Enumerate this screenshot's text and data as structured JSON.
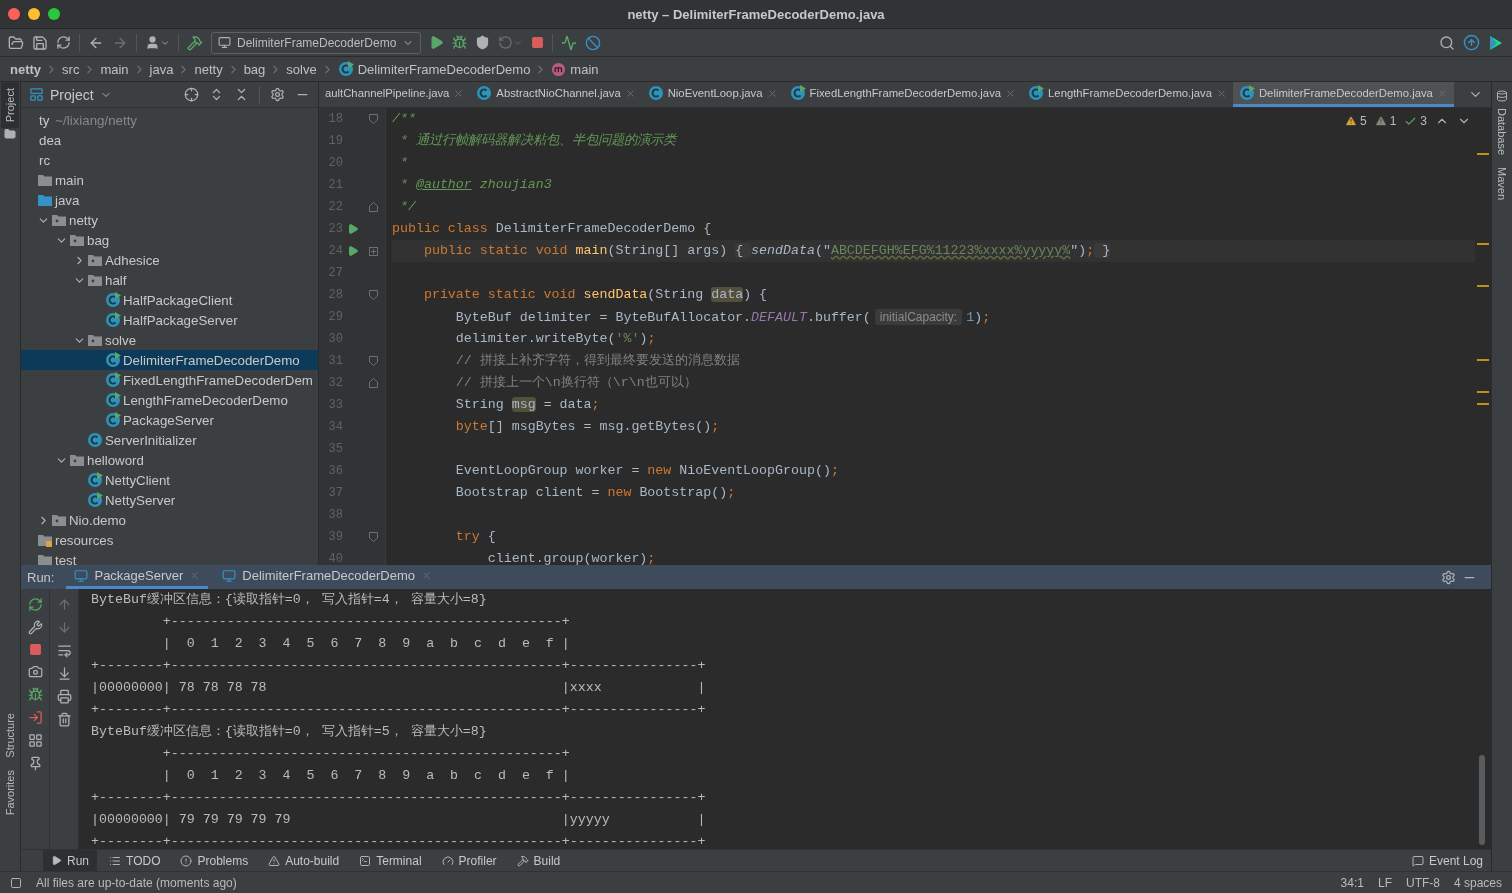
{
  "window": {
    "title": "netty – DelimiterFrameDecoderDemo.java"
  },
  "toolbar": {
    "run_config": "DelimiterFrameDecoderDemo"
  },
  "breadcrumb": [
    {
      "label": "netty",
      "kind": "root"
    },
    {
      "label": "src",
      "kind": "dir"
    },
    {
      "label": "main",
      "kind": "dir"
    },
    {
      "label": "java",
      "kind": "dir"
    },
    {
      "label": "netty",
      "kind": "dir"
    },
    {
      "label": "bag",
      "kind": "dir"
    },
    {
      "label": "solve",
      "kind": "dir"
    },
    {
      "label": "DelimiterFrameDecoderDemo",
      "kind": "class"
    },
    {
      "label": "main",
      "kind": "method"
    }
  ],
  "left_strip": [
    {
      "label": "Project",
      "selected": true
    },
    {
      "label": "Structure",
      "selected": false
    },
    {
      "label": "Favorites",
      "selected": false
    }
  ],
  "right_strip": [
    {
      "label": "Database"
    },
    {
      "label": "Maven"
    }
  ],
  "project_panel": {
    "title": "Project",
    "tree": [
      {
        "label": "ty",
        "path": "~/lixiang/netty",
        "selected": false,
        "children": [
          {
            "label": "dea",
            "selected": false
          },
          {
            "label": "rc",
            "selected": false,
            "children": [
              {
                "label": "main",
                "kind": "folder",
                "selected": false,
                "children": [
                  {
                    "label": "java",
                    "kind": "source",
                    "selected": false,
                    "children": [
                      {
                        "label": "netty",
                        "kind": "package",
                        "expanded": true,
                        "selected": false,
                        "children": [
                          {
                            "label": "bag",
                            "kind": "package",
                            "expanded": true,
                            "selected": false,
                            "children": [
                              {
                                "label": "Adhesice",
                                "kind": "package",
                                "expanded": false,
                                "selected": false
                              },
                              {
                                "label": "half",
                                "kind": "package",
                                "expanded": true,
                                "selected": false,
                                "children": [
                                  {
                                    "label": "HalfPackageClient",
                                    "kind": "runnable",
                                    "selected": false
                                  },
                                  {
                                    "label": "HalfPackageServer",
                                    "kind": "runnable",
                                    "selected": false
                                  }
                                ]
                              },
                              {
                                "label": "solve",
                                "kind": "package",
                                "expanded": true,
                                "selected": false,
                                "children": [
                                  {
                                    "label": "DelimiterFrameDecoderDemo",
                                    "kind": "runnable",
                                    "selected": true
                                  },
                                  {
                                    "label": "FixedLengthFrameDecoderDem",
                                    "kind": "runnable",
                                    "selected": false
                                  },
                                  {
                                    "label": "LengthFrameDecoderDemo",
                                    "kind": "runnable",
                                    "selected": false
                                  },
                                  {
                                    "label": "PackageServer",
                                    "kind": "runnable",
                                    "selected": false
                                  }
                                ]
                              },
                              {
                                "label": "ServerInitializer",
                                "kind": "class",
                                "selected": false
                              }
                            ]
                          },
                          {
                            "label": "helloword",
                            "kind": "package",
                            "expanded": true,
                            "selected": false,
                            "children": [
                              {
                                "label": "NettyClient",
                                "kind": "runnable",
                                "selected": false
                              },
                              {
                                "label": "NettyServer",
                                "kind": "runnable",
                                "selected": false
                              }
                            ]
                          }
                        ]
                      },
                      {
                        "label": "Nio.demo",
                        "kind": "package",
                        "expanded": false,
                        "selected": false
                      }
                    ]
                  },
                  {
                    "label": "resources",
                    "kind": "resources",
                    "selected": false
                  }
                ]
              },
              {
                "label": "test",
                "kind": "folder",
                "selected": false
              }
            ]
          }
        ]
      }
    ]
  },
  "editor_tabs": [
    {
      "label": "aultChannelPipeline.java",
      "selected": false
    },
    {
      "label": "AbstractNioChannel.java",
      "selected": false
    },
    {
      "label": "NioEventLoop.java",
      "selected": false
    },
    {
      "label": "FixedLengthFrameDecoderDemo.java",
      "selected": false
    },
    {
      "label": "LengthFrameDecoderDemo.java",
      "selected": false
    },
    {
      "label": "DelimiterFrameDecoderDemo.java",
      "selected": true
    }
  ],
  "inspections": [
    {
      "kind": "warning",
      "count": "5"
    },
    {
      "kind": "weak",
      "count": "1"
    },
    {
      "kind": "ok",
      "count": "3"
    }
  ],
  "code": [
    {
      "n": "18",
      "run": false,
      "fold_start": true,
      "fold_end": false,
      "collapsed": false,
      "tokens": [
        {
          "t": "/**",
          "kind": "doc"
        }
      ]
    },
    {
      "n": "19",
      "run": false,
      "fold_start": false,
      "fold_end": false,
      "collapsed": false,
      "tokens": [
        {
          "t": " * 通过行帧解码器解决粘包、半包问题的演示类",
          "kind": "doc"
        }
      ]
    },
    {
      "n": "20",
      "run": false,
      "fold_start": false,
      "fold_end": false,
      "collapsed": false,
      "tokens": [
        {
          "t": " *",
          "kind": "doc"
        }
      ]
    },
    {
      "n": "21",
      "run": false,
      "fold_start": false,
      "fold_end": false,
      "collapsed": false,
      "tokens": [
        {
          "t": " * ",
          "kind": "doc"
        },
        {
          "t": "@author",
          "kind": "doctag"
        },
        {
          "t": " zhoujian3",
          "kind": "doc"
        }
      ]
    },
    {
      "n": "22",
      "run": false,
      "fold_start": false,
      "fold_end": true,
      "collapsed": false,
      "tokens": [
        {
          "t": " */",
          "kind": "doc"
        }
      ]
    },
    {
      "n": "23",
      "run": true,
      "fold_start": false,
      "fold_end": false,
      "collapsed": false,
      "tokens": [
        {
          "t": "public class ",
          "kind": "kw"
        },
        {
          "t": "DelimiterFrameDecoderDemo {",
          "kind": "plain"
        }
      ]
    },
    {
      "n": "24",
      "run": true,
      "fold_start": false,
      "fold_end": false,
      "collapsed": true,
      "tokens": [
        {
          "t": "    public static void ",
          "kind": "kw"
        },
        {
          "t": "main",
          "kind": "fn"
        },
        {
          "t": "(String[] args) ",
          "kind": "plain"
        },
        {
          "t": "{ ",
          "kind": "folded"
        },
        {
          "t": "sendData",
          "kind": "call"
        },
        {
          "t": "(\"",
          "kind": "plain"
        },
        {
          "t": "ABCDEFGH%EFG%11223%xxxx%yyyyy%",
          "kind": "str"
        },
        {
          "t": "\")",
          "kind": "plain"
        },
        {
          "t": ";",
          "kind": "kw"
        },
        {
          "t": " }",
          "kind": "folded"
        }
      ]
    },
    {
      "n": "27",
      "run": false,
      "fold_start": false,
      "fold_end": false,
      "collapsed": false
    },
    {
      "n": "28",
      "run": false,
      "fold_start": true,
      "fold_end": false,
      "collapsed": false,
      "tokens": [
        {
          "t": "    private static void ",
          "kind": "kw"
        },
        {
          "t": "sendData",
          "kind": "fn"
        },
        {
          "t": "(String ",
          "kind": "plain"
        },
        {
          "t": "data",
          "kind": "hl"
        },
        {
          "t": ") {",
          "kind": "plain"
        }
      ]
    },
    {
      "n": "29",
      "run": false,
      "fold_start": false,
      "fold_end": false,
      "collapsed": false,
      "tokens": [
        {
          "t": "        ByteBuf delimiter = ByteBufAllocator.",
          "kind": "plain"
        },
        {
          "t": "DEFAULT",
          "kind": "static"
        },
        {
          "t": ".buffer(",
          "kind": "plain"
        },
        {
          "t": "initialCapacity:",
          "kind": "hint"
        },
        {
          "t": "1",
          "kind": "num"
        },
        {
          "t": ")",
          "kind": "plain"
        },
        {
          "t": ";",
          "kind": "kw"
        }
      ]
    },
    {
      "n": "30",
      "run": false,
      "fold_start": false,
      "fold_end": false,
      "collapsed": false,
      "tokens": [
        {
          "t": "        delimiter.writeByte(",
          "kind": "plain"
        },
        {
          "t": "'%'",
          "kind": "str"
        },
        {
          "t": ")",
          "kind": "plain"
        },
        {
          "t": ";",
          "kind": "kw"
        }
      ]
    },
    {
      "n": "31",
      "run": false,
      "fold_start": true,
      "fold_end": false,
      "collapsed": false,
      "tokens": [
        {
          "t": "        // 拼接上补齐字符，得到最终要发送的消息数据",
          "kind": "cmt"
        }
      ]
    },
    {
      "n": "32",
      "run": false,
      "fold_start": false,
      "fold_end": true,
      "collapsed": false,
      "tokens": [
        {
          "t": "        // 拼接上一个\\n换行符（\\r\\n也可以）",
          "kind": "cmt"
        }
      ]
    },
    {
      "n": "33",
      "run": false,
      "fold_start": false,
      "fold_end": false,
      "collapsed": false,
      "tokens": [
        {
          "t": "        String ",
          "kind": "plain"
        },
        {
          "t": "msg",
          "kind": "hl"
        },
        {
          "t": " = data",
          "kind": "plain"
        },
        {
          "t": ";",
          "kind": "kw"
        }
      ]
    },
    {
      "n": "34",
      "run": false,
      "fold_start": false,
      "fold_end": false,
      "collapsed": false,
      "tokens": [
        {
          "t": "        byte",
          "kind": "kw"
        },
        {
          "t": "[] msgBytes = msg.getBytes()",
          "kind": "plain"
        },
        {
          "t": ";",
          "kind": "kw"
        }
      ]
    },
    {
      "n": "35",
      "run": false,
      "fold_start": false,
      "fold_end": false,
      "collapsed": false
    },
    {
      "n": "36",
      "run": false,
      "fold_start": false,
      "fold_end": false,
      "collapsed": false,
      "tokens": [
        {
          "t": "        EventLoopGroup worker = ",
          "kind": "plain"
        },
        {
          "t": "new",
          "kind": "kw"
        },
        {
          "t": " NioEventLoopGroup()",
          "kind": "plain"
        },
        {
          "t": ";",
          "kind": "kw"
        }
      ]
    },
    {
      "n": "37",
      "run": false,
      "fold_start": false,
      "fold_end": false,
      "collapsed": false,
      "tokens": [
        {
          "t": "        Bootstrap client = ",
          "kind": "plain"
        },
        {
          "t": "new",
          "kind": "kw"
        },
        {
          "t": " Bootstrap()",
          "kind": "plain"
        },
        {
          "t": ";",
          "kind": "kw"
        }
      ]
    },
    {
      "n": "38",
      "run": false,
      "fold_start": false,
      "fold_end": false,
      "collapsed": false
    },
    {
      "n": "39",
      "run": false,
      "fold_start": true,
      "fold_end": false,
      "collapsed": false,
      "tokens": [
        {
          "t": "        try",
          "kind": "kw"
        },
        {
          "t": " {",
          "kind": "plain"
        }
      ]
    },
    {
      "n": "40",
      "run": false,
      "fold_start": false,
      "fold_end": false,
      "collapsed": false,
      "tokens": [
        {
          "t": "            client.group(worker)",
          "kind": "plain"
        },
        {
          "t": ";",
          "kind": "kw"
        }
      ]
    }
  ],
  "run_panel": {
    "label": "Run:",
    "tabs": [
      {
        "label": "PackageServer",
        "selected": true
      },
      {
        "label": "DelimiterFrameDecoderDemo",
        "selected": false
      }
    ],
    "console": [
      "ByteBuf缓冲区信息：{读取指针=0， 写入指针=4， 容量大小=8}",
      "         +-------------------------------------------------+",
      "         |  0  1  2  3  4  5  6  7  8  9  a  b  c  d  e  f |",
      "+--------+-------------------------------------------------+----------------+",
      "|00000000| 78 78 78 78                                     |xxxx            |",
      "+--------+-------------------------------------------------+----------------+",
      "ByteBuf缓冲区信息：{读取指针=0， 写入指针=5， 容量大小=8}",
      "         +-------------------------------------------------+",
      "         |  0  1  2  3  4  5  6  7  8  9  a  b  c  d  e  f |",
      "+--------+-------------------------------------------------+----------------+",
      "|00000000| 79 79 79 79 79                                  |yyyyy           |",
      "+--------+-------------------------------------------------+----------------+"
    ]
  },
  "tool_tabs": [
    {
      "label": "Run",
      "kind": "run",
      "selected": true
    },
    {
      "label": "TODO",
      "kind": "todo",
      "selected": false
    },
    {
      "label": "Problems",
      "kind": "problems",
      "selected": false
    },
    {
      "label": "Auto-build",
      "kind": "build-warning",
      "selected": false
    },
    {
      "label": "Terminal",
      "kind": "terminal",
      "selected": false
    },
    {
      "label": "Profiler",
      "kind": "profiler",
      "selected": false
    },
    {
      "label": "Build",
      "kind": "build",
      "selected": false
    }
  ],
  "event_log": "Event Log",
  "status_bar": {
    "message": "All files are up-to-date (moments ago)",
    "items": [
      "34:1",
      "LF",
      "UTF-8",
      "4 spaces"
    ]
  }
}
